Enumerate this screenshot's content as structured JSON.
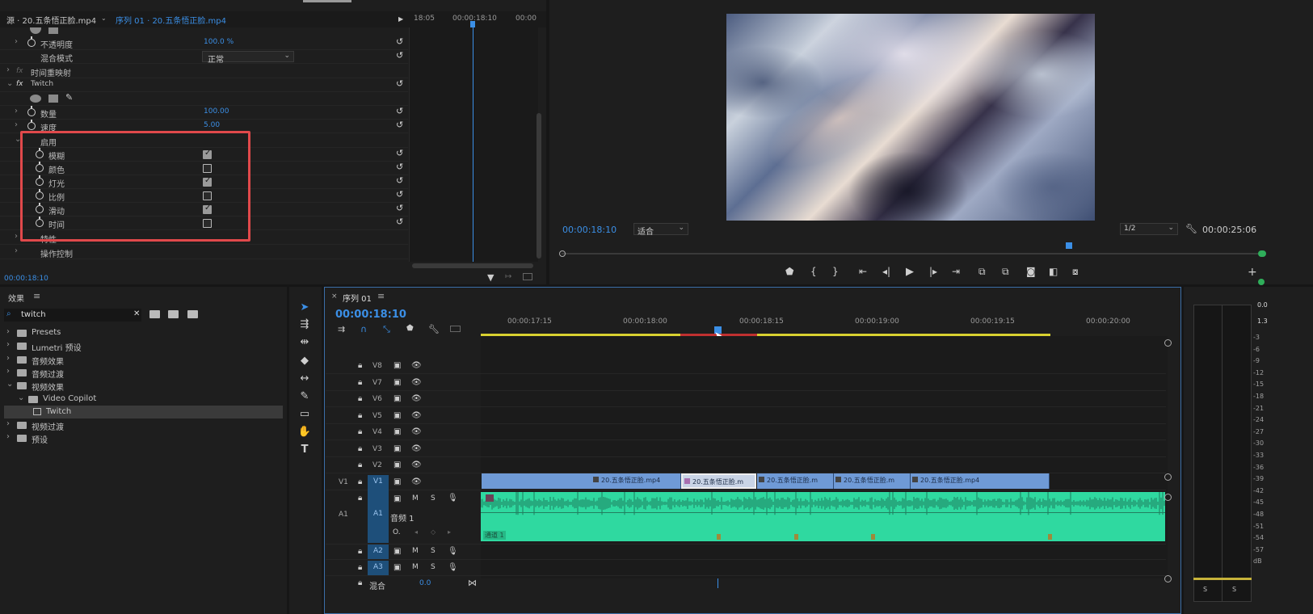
{
  "effect_controls": {
    "source_tab": "源 · 20.五条悟正脸.mp4",
    "sequence_tab": "序列 01 · 20.五条悟正脸.mp4",
    "ruler": [
      "18:05",
      "00:00:18:10",
      "00:00"
    ],
    "opacity_label": "不透明度",
    "opacity_value": "100.0 %",
    "blend_label": "混合模式",
    "blend_value": "正常",
    "time_remap": "时间重映射",
    "twitch_label": "Twitch",
    "amount_label": "数量",
    "amount_value": "100.00",
    "speed_label": "速度",
    "speed_value": "5.00",
    "enable_label": "启用",
    "enable_items": [
      {
        "label": "模糊",
        "checked": true
      },
      {
        "label": "颜色",
        "checked": false
      },
      {
        "label": "灯光",
        "checked": true
      },
      {
        "label": "比例",
        "checked": false
      },
      {
        "label": "滑动",
        "checked": true
      },
      {
        "label": "时间",
        "checked": false
      }
    ],
    "extra_label": "特性",
    "operation_label": "操作控制",
    "current_time": "00:00:18:10"
  },
  "program_monitor": {
    "timecode": "00:00:18:10",
    "fit_label": "适合",
    "quality": "1/2",
    "duration": "00:00:25:06"
  },
  "effects_panel": {
    "title": "效果",
    "search_value": "twitch",
    "tree": [
      {
        "label": "Presets",
        "indent": 0
      },
      {
        "label": "Lumetri 预设",
        "indent": 0
      },
      {
        "label": "音频效果",
        "indent": 0
      },
      {
        "label": "音频过渡",
        "indent": 0
      },
      {
        "label": "视频效果",
        "indent": 0
      },
      {
        "label": "Video Copilot",
        "indent": 1
      },
      {
        "label": "Twitch",
        "indent": 2
      },
      {
        "label": "视频过渡",
        "indent": 0
      },
      {
        "label": "预设",
        "indent": 0
      }
    ]
  },
  "timeline": {
    "tab": "序列 01",
    "timecode": "00:00:18:10",
    "ruler": [
      "00:00:17:15",
      "00:00:18:00",
      "00:00:18:15",
      "00:00:19:00",
      "00:00:19:15",
      "00:00:20:00"
    ],
    "video_tracks": [
      "V8",
      "V7",
      "V6",
      "V5",
      "V4",
      "V3",
      "V2",
      "V1"
    ],
    "audio_tracks": [
      "A1",
      "A2",
      "A3"
    ],
    "clips": [
      "20.五条悟正脸.mp4",
      "20.五条悟正脸.m",
      "20.五条悟正脸.m",
      "20.五条悟正脸.m",
      "20.五条悟正脸.mp4"
    ],
    "audio_name": "音频 1",
    "mix_label": "混合",
    "mix_value": "0.0",
    "track_m": "M",
    "track_s": "S",
    "channel_label": "通道 1",
    "v1_src": "V1",
    "a1_src": "A1"
  },
  "audio_meter": {
    "labels": [
      "0.0",
      "1.3",
      "-3",
      "-6",
      "-9",
      "-12",
      "-15",
      "-18",
      "-21",
      "-24",
      "-27",
      "-30",
      "-33",
      "-36",
      "-39",
      "-42",
      "-45",
      "-48",
      "-51",
      "-54",
      "-57",
      "dB"
    ],
    "solo": [
      "S",
      "S"
    ]
  }
}
